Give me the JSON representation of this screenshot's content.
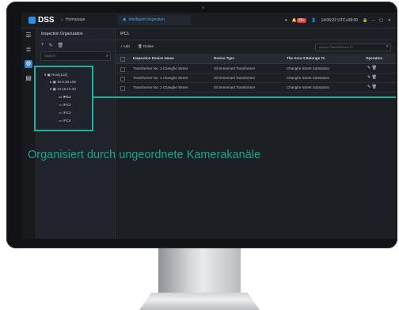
{
  "app": {
    "logo_text": "DSS",
    "tabs": [
      {
        "label": "Homepage",
        "icon": "home-icon"
      },
      {
        "label": "Intelligent Inspection",
        "icon": "inspection-icon"
      }
    ],
    "topbar": {
      "alarm_badge": "99+",
      "user": "admin",
      "clock": "14:06:22  UTC+08:00"
    }
  },
  "tree": {
    "title": "Inspection Organization",
    "search_placeholder": "Search",
    "nodes": [
      {
        "label": "Root(123)",
        "level": 0
      },
      {
        "label": "10.0.36.103",
        "level": 1
      },
      {
        "label": "10.18.10.10",
        "level": 1
      },
      {
        "label": "IPC1",
        "level": 2,
        "selected": true
      },
      {
        "label": "IPC2",
        "level": 2
      },
      {
        "label": "IPC3",
        "level": 2
      },
      {
        "label": "IPC4",
        "level": 2
      }
    ]
  },
  "main": {
    "breadcrumb": "IPC1",
    "actions": {
      "add": "Add",
      "delete": "Delete"
    },
    "search_placeholder": "Inspect Name/Device IP",
    "columns": [
      "Inspection Device Name",
      "Device Type",
      "The Area It Belongs To",
      "Operation"
    ],
    "rows": [
      [
        "Transformer No. 1 Changhe Street",
        "Oil Immersed Transformer",
        "Changhe Street Substation"
      ],
      [
        "Transformer No. 1 Changhe Street",
        "Oil Immersed Transformer",
        "Changhe Street Substation"
      ],
      [
        "Transformer No. 1 Changhe Street",
        "Oil Immersed Transformer",
        "Changhe Street Substation"
      ]
    ]
  },
  "annotation": {
    "caption": "Organisiert durch ungeordnete Kamerakanäle",
    "color": "#1fb39c"
  }
}
